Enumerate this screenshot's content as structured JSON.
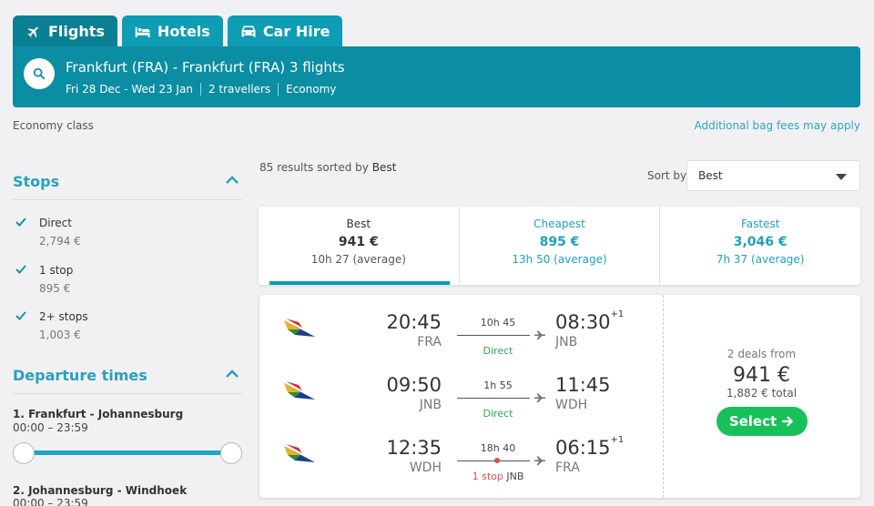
{
  "tabs": [
    {
      "label": "Flights",
      "icon": "plane-icon"
    },
    {
      "label": "Hotels",
      "icon": "bed-icon"
    },
    {
      "label": "Car Hire",
      "icon": "car-icon"
    }
  ],
  "search": {
    "title": "Frankfurt (FRA) - Frankfurt (FRA) 3 flights",
    "dates": "Fri 28 Dec - Wed 23 Jan",
    "travellers": "2 travellers",
    "cabin": "Economy"
  },
  "economy_class": "Economy class",
  "bag_fees": "Additional bag fees may apply",
  "filters": {
    "stops_title": "Stops",
    "stops": [
      {
        "label": "Direct",
        "price": "2,794 €",
        "checked": true
      },
      {
        "label": "1 stop",
        "price": "895 €",
        "checked": true
      },
      {
        "label": "2+ stops",
        "price": "1,003 €",
        "checked": true
      }
    ],
    "departure_title": "Departure times",
    "routes": [
      {
        "label": "1. Frankfurt - Johannesburg",
        "time": "00:00 – 23:59"
      },
      {
        "label": "2. Johannesburg - Windhoek",
        "time": "00:00 – 23:59"
      }
    ]
  },
  "results": {
    "count_text": "85 results sorted by",
    "sorted_by": "Best",
    "sort_label": "Sort by",
    "sort_value": "Best"
  },
  "sort_tabs": [
    {
      "name": "Best",
      "price": "941 €",
      "duration": "10h 27 (average)"
    },
    {
      "name": "Cheapest",
      "price": "895 €",
      "duration": "13h 50 (average)"
    },
    {
      "name": "Fastest",
      "price": "3,046 €",
      "duration": "7h 37 (average)"
    }
  ],
  "itinerary": {
    "legs": [
      {
        "dep_time": "20:45",
        "dep_airport": "FRA",
        "duration": "10h 45",
        "stops": "Direct",
        "stop_city": "",
        "arr_time": "08:30",
        "arr_plus": "+1",
        "arr_airport": "JNB"
      },
      {
        "dep_time": "09:50",
        "dep_airport": "JNB",
        "duration": "1h 55",
        "stops": "Direct",
        "stop_city": "",
        "arr_time": "11:45",
        "arr_plus": "",
        "arr_airport": "WDH"
      },
      {
        "dep_time": "12:35",
        "dep_airport": "WDH",
        "duration": "18h 40",
        "stops": "1 stop",
        "stop_city": "JNB",
        "arr_time": "06:15",
        "arr_plus": "+1",
        "arr_airport": "FRA"
      }
    ],
    "deals": "2 deals from",
    "price": "941 €",
    "total": "1,882 € total",
    "select_label": "Select"
  },
  "colors": {
    "tab_blue": "#0f9cb5",
    "search_bar": "#0b8da3",
    "accent": "#2aa0bd",
    "direct_green": "#2aa952",
    "stop_red": "#e04a4a",
    "select_green": "#17c15a"
  }
}
